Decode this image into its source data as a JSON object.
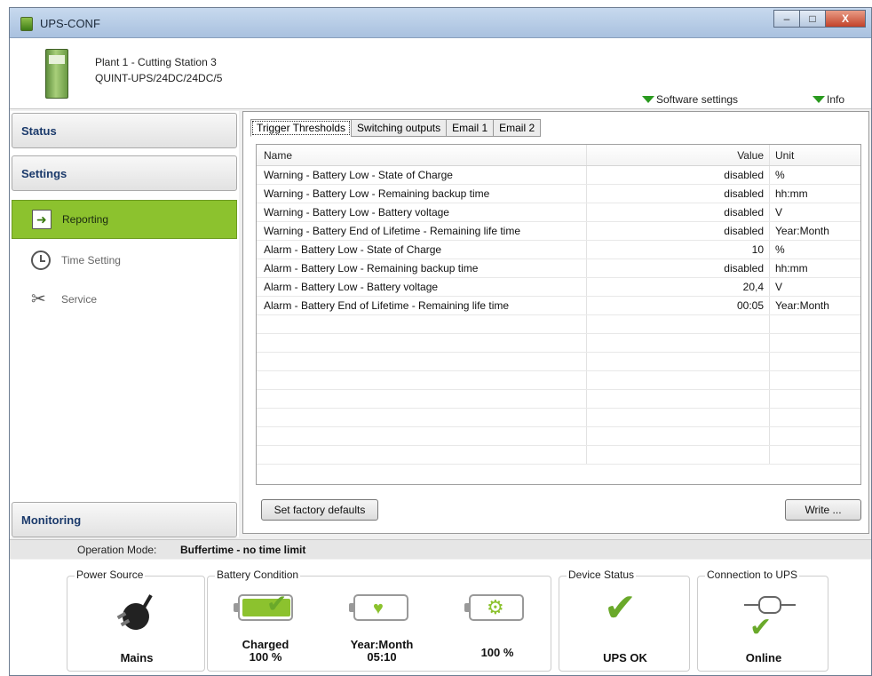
{
  "window": {
    "title": "UPS-CONF",
    "minimize": "–",
    "maximize": "□",
    "close": "X"
  },
  "device": {
    "line1": "Plant 1 - Cutting Station 3",
    "line2": "QUINT-UPS/24DC/24DC/5"
  },
  "header_links": {
    "software_settings": "Software settings",
    "info": "Info"
  },
  "nav": {
    "status": "Status",
    "settings": "Settings",
    "items": [
      {
        "label": "Reporting",
        "icon": "report-icon",
        "active": true
      },
      {
        "label": "Time Setting",
        "icon": "clock-icon",
        "active": false
      },
      {
        "label": "Service",
        "icon": "tools-icon",
        "active": false
      }
    ],
    "monitoring": "Monitoring"
  },
  "tabs": [
    "Trigger Thresholds",
    "Switching outputs",
    "Email 1",
    "Email 2"
  ],
  "table": {
    "columns": [
      "Name",
      "Value",
      "Unit"
    ],
    "rows": [
      [
        "Warning - Battery Low - State of Charge",
        "disabled",
        "%"
      ],
      [
        "Warning - Battery Low - Remaining backup time",
        "disabled",
        "hh:mm"
      ],
      [
        "Warning - Battery Low - Battery voltage",
        "disabled",
        "V"
      ],
      [
        "Warning - Battery End of Lifetime - Remaining life time",
        "disabled",
        "Year:Month"
      ],
      [
        "Alarm - Battery Low - State of Charge",
        "10",
        "%"
      ],
      [
        "Alarm - Battery Low - Remaining backup time",
        "disabled",
        "hh:mm"
      ],
      [
        "Alarm - Battery Low - Battery voltage",
        "20,4",
        "V"
      ],
      [
        "Alarm - Battery End of Lifetime - Remaining life time",
        "00:05",
        "Year:Month"
      ],
      [
        "",
        "",
        ""
      ],
      [
        "",
        "",
        ""
      ],
      [
        "",
        "",
        ""
      ],
      [
        "",
        "",
        ""
      ],
      [
        "",
        "",
        ""
      ],
      [
        "",
        "",
        ""
      ],
      [
        "",
        "",
        ""
      ],
      [
        "",
        "",
        ""
      ]
    ]
  },
  "buttons": {
    "factory": "Set factory defaults",
    "write": "Write ..."
  },
  "operation_mode": {
    "label": "Operation Mode:",
    "value": "Buffertime - no time limit"
  },
  "status": {
    "power_source": {
      "title": "Power Source",
      "value": "Mains"
    },
    "battery_condition": {
      "title": "Battery Condition",
      "charged_label": "Charged",
      "charged_value": "100 %",
      "life_label": "Year:Month",
      "life_value": "05:10",
      "health_value": "100 %"
    },
    "device_status": {
      "title": "Device Status",
      "value": "UPS OK"
    },
    "connection": {
      "title": "Connection to UPS",
      "value": "Online"
    }
  },
  "colors": {
    "accent_green": "#8cc22e",
    "check_green": "#6aa92a",
    "nav_blue": "#1b3a6b"
  }
}
